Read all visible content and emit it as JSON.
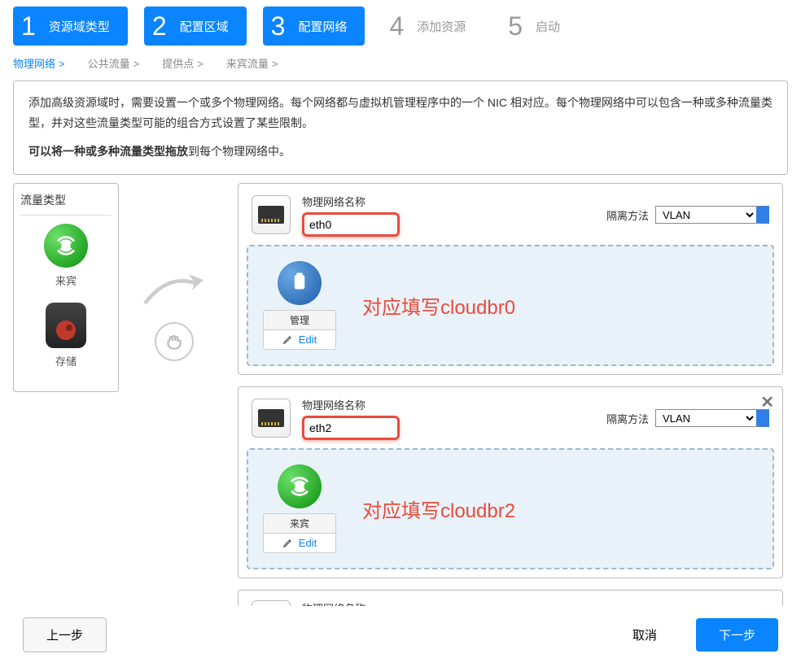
{
  "wizard": {
    "steps": [
      {
        "num": "1",
        "label": "资源域类型",
        "active": true
      },
      {
        "num": "2",
        "label": "配置区域",
        "active": true
      },
      {
        "num": "3",
        "label": "配置网络",
        "active": true
      },
      {
        "num": "4",
        "label": "添加资源",
        "active": false
      },
      {
        "num": "5",
        "label": "启动",
        "active": false
      }
    ]
  },
  "subtabs": {
    "physical": "物理网络",
    "public": "公共流量",
    "pod": "提供点",
    "guest": "来宾流量",
    "chev": ">"
  },
  "description": {
    "p1": "添加高级资源域时，需要设置一个或多个物理网络。每个网络都与虚拟机管理程序中的一个 NIC 相对应。每个物理网络中可以包含一种或多种流量类型，并对这些流量类型可能的组合方式设置了某些限制。",
    "p2_prefix": "可以将一种或多种流量类型拖放",
    "p2_suffix": "到每个物理网络中。"
  },
  "traffic": {
    "title": "流量类型",
    "guest": "来宾",
    "storage": "存储"
  },
  "network_card": {
    "name_label": "物理网络名称",
    "isolation_label": "隔离方法",
    "isolation_value": "VLAN",
    "edit": "Edit"
  },
  "networks": [
    {
      "name_value": "eth0",
      "highlight": true,
      "closable": false,
      "assigned": {
        "kind": "mgmt",
        "label": "管理"
      },
      "annotation": "对应填写cloudbr0"
    },
    {
      "name_value": "eth2",
      "highlight": true,
      "closable": true,
      "assigned": {
        "kind": "guest",
        "label": "来宾"
      },
      "annotation": "对应填写cloudbr2"
    },
    {
      "name_value": "",
      "highlight": false,
      "closable": false,
      "assigned": null,
      "annotation": ""
    }
  ],
  "footer": {
    "prev": "上一步",
    "cancel": "取消",
    "next": "下一步"
  }
}
